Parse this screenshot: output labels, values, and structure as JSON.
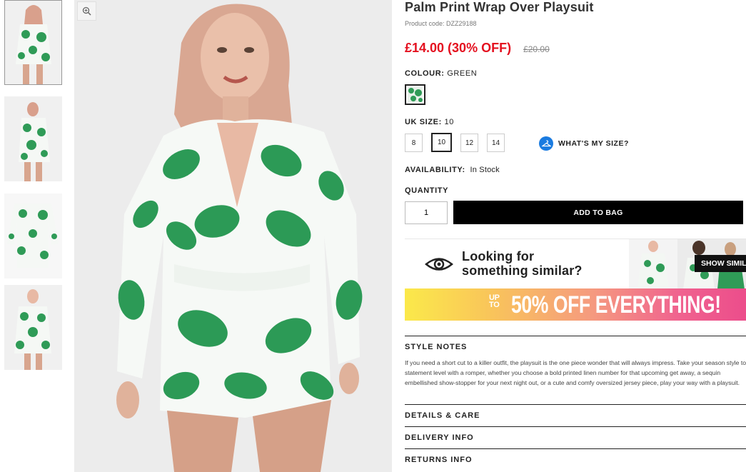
{
  "product": {
    "title": "Palm Print Wrap Over Playsuit",
    "code": "Product code: DZZ29188",
    "price": "£14.00 (30% OFF)",
    "old_price": "£20.00"
  },
  "colour": {
    "label": "COLOUR:",
    "value": "GREEN"
  },
  "size": {
    "label": "UK SIZE:",
    "value": "10",
    "options": [
      "8",
      "10",
      "12",
      "14"
    ],
    "selected": "10",
    "whats_my_size": "WHAT'S MY SIZE?"
  },
  "availability": {
    "label": "AVAILABILITY:",
    "value": "In Stock"
  },
  "quantity": {
    "label": "QUANTITY",
    "value": "1"
  },
  "add_to_bag": "ADD TO BAG",
  "similar": {
    "line1": "Looking for",
    "line2": "something similar?",
    "button": "SHOW SIMILAR"
  },
  "promo": {
    "upto_line1": "UP",
    "upto_line2": "TO",
    "headline": "50% OFF EVERYTHING!"
  },
  "sections": {
    "style_notes_title": "STYLE NOTES",
    "style_notes_body": "If you need a short cut to a killer outfit, the playsuit is the one piece wonder that will always impress. Take your season style to statement level with a romper, whether you choose a bold printed linen number for that upcoming get away, a sequin embellished show-stopper for your next night out, or a cute and comfy oversized jersey piece, play your way with a playsuit.",
    "details_care": "DETAILS & CARE",
    "delivery_info": "DELIVERY INFO",
    "returns_info": "RETURNS INFO"
  },
  "icons": {
    "zoom": "zoom-in-icon",
    "eye": "eye-icon",
    "hanger": "hanger-icon"
  },
  "colors": {
    "price_red": "#e4101f",
    "button_black": "#000000",
    "size_help_blue": "#1a7be0",
    "print_green": "#2f9b57"
  }
}
